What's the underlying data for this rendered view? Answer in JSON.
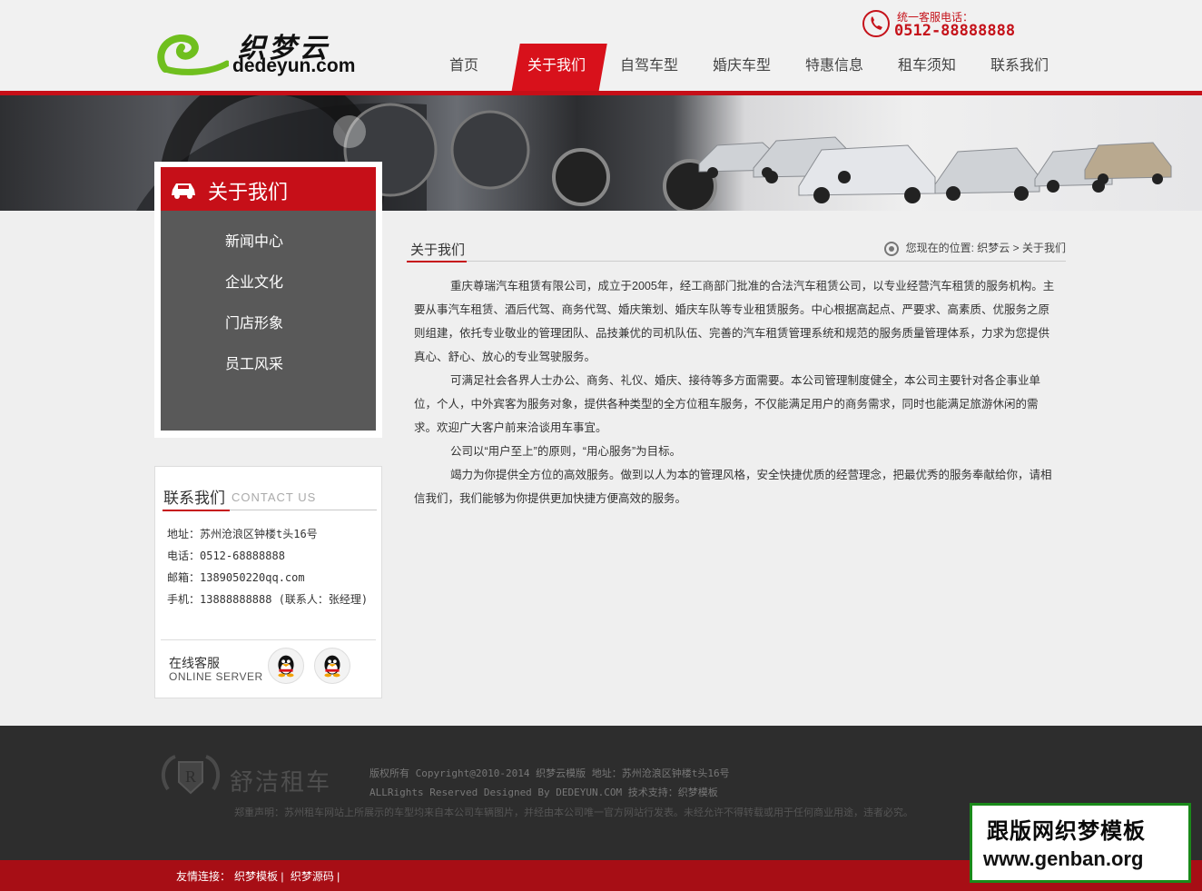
{
  "header": {
    "logo_cn": "织梦云",
    "logo_en": "dedeyun.com",
    "hotline_label": "统一客服电话：",
    "hotline_number": "0512-88888888"
  },
  "nav": {
    "items": [
      "首页",
      "关于我们",
      "自驾车型",
      "婚庆车型",
      "特惠信息",
      "租车须知",
      "联系我们"
    ],
    "active": "关于我们"
  },
  "sidebar": {
    "title": "关于我们",
    "items": [
      "新闻中心",
      "企业文化",
      "门店形象",
      "员工风采"
    ]
  },
  "contact": {
    "title": "联系我们",
    "subtitle": "CONTACT US",
    "address": "地址：苏州沧浪区钟楼t头16号",
    "tel": "电话：0512-68888888",
    "email": "邮箱：1389050220qq.com",
    "mobile": "手机：13888888888 (联系人：张经理)",
    "service_cn": "在线客服",
    "service_en": "ONLINE SERVER"
  },
  "main": {
    "title": "关于我们",
    "breadcrumb": "您现在的位置: 织梦云 > 关于我们",
    "paragraphs": [
      "重庆尊瑞汽车租赁有限公司，成立于2005年，经工商部门批准的合法汽车租赁公司，以专业经营汽车租赁的服务机构。主要从事汽车租赁、酒后代驾、商务代驾、婚庆策划、婚庆车队等专业租赁服务。中心根据高起点、严要求、高素质、优服务之原则组建，依托专业敬业的管理团队、品技兼优的司机队伍、完善的汽车租赁管理系统和规范的服务质量管理体系，力求为您提供真心、舒心、放心的专业驾驶服务。",
      "可满足社会各界人士办公、商务、礼仪、婚庆、接待等多方面需要。本公司管理制度健全，本公司主要针对各企事业单位，个人，中外宾客为服务对象，提供各种类型的全方位租车服务，不仅能满足用户的商务需求，同时也能满足旅游休闲的需求。欢迎广大客户前来洽谈用车事宜。",
      "公司以“用户至上”的原则，“用心服务”为目标。",
      "竭力为你提供全方位的高效服务。做到以人为本的管理风格，安全快捷优质的经营理念，把最优秀的服务奉献给你，请相信我们，我们能够为你提供更加快捷方便高效的服务。"
    ]
  },
  "footer": {
    "brand": "舒洁租车",
    "copyright": "版权所有 Copyright@2010-2014 织梦云模版 地址：苏州沧浪区钟楼t头16号",
    "designed": "ALLRights Reserved Designed By DEDEYUN.COM 技术支持：织梦模板",
    "notice": "郑重声明：苏州租车网站上所展示的车型均来自本公司车辆图片，并经由本公司唯一官方网站行发表。未经允许不得转载或用于任何商业用途，违者必究。",
    "links_label": "友情连接：",
    "links": [
      "织梦模板",
      "织梦源码"
    ]
  },
  "watermark": {
    "line1": "跟版网织梦模板",
    "line2": "www.genban.org"
  },
  "colors": {
    "accent": "#c60f18",
    "sidebar_bg": "#595959",
    "footer_bg": "#2d2d2d"
  }
}
